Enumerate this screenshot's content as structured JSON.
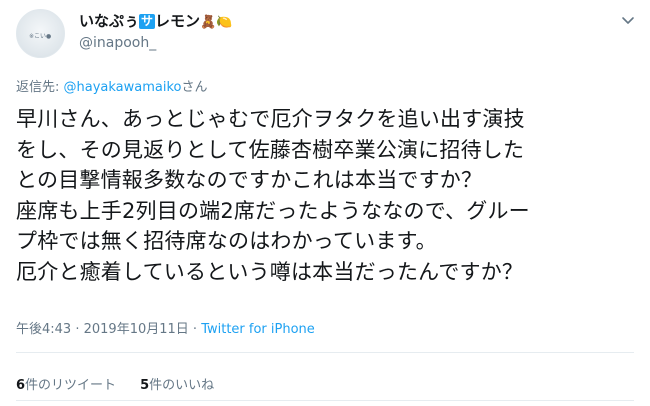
{
  "author": {
    "display_name": "いなぷぅ",
    "badge": "サ",
    "name_suffix": "レモン",
    "emoji": "🧸🍋",
    "handle": "@inapooh_",
    "avatar_text": "※こい●"
  },
  "reply": {
    "prefix": "返信先: ",
    "mention": "@hayakawamaiko",
    "suffix": "さん"
  },
  "tweet": {
    "text": "早川さん、あっとじゃむで厄介ヲタクを追い出す演技\nをし、その見返りとして佐藤杏樹卒業公演に招待した\nとの目撃情報多数なのですかこれは本当ですか？\n座席も上手2列目の端2席だったようななので、グルー\nプ枠では無く招待席なのはわかっています。\n厄介と癒着しているという噂は本当だったんですか？"
  },
  "meta": {
    "time": "午後4:43",
    "sep1": " · ",
    "date": "2019年10月11日",
    "sep2": " · ",
    "source": "Twitter for iPhone"
  },
  "stats": {
    "retweets_count": "6",
    "retweets_label": "件のリツイート",
    "likes_count": "5",
    "likes_label": "件のいいね"
  },
  "colors": {
    "accent": "#1da1f2",
    "text": "#14171a",
    "muted": "#657786",
    "divider": "#e6ecf0"
  }
}
